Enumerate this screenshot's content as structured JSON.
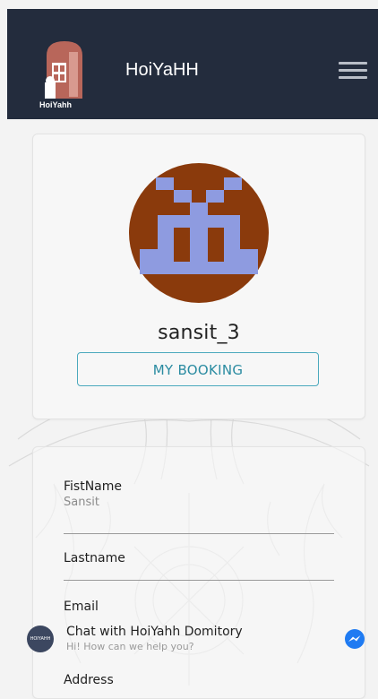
{
  "navbar": {
    "brand_logo_text": "HoiYahh",
    "brand_title": "HoiYaHH",
    "menu_icon": "hamburger-icon"
  },
  "profile": {
    "username": "sansit_3",
    "booking_button": "MY BOOKING",
    "avatar_colors": {
      "background": "#8a3a0c",
      "pattern": "#8e9be0"
    }
  },
  "form": {
    "fields": [
      {
        "label": "FistName",
        "value": "Sansit"
      },
      {
        "label": "Lastname",
        "value": ""
      },
      {
        "label": "Email",
        "value": ""
      },
      {
        "label": "Address",
        "value": ""
      }
    ]
  },
  "chat": {
    "title": "Chat with HoiYahh Domitory",
    "subtitle": "Hi! How can we help you?",
    "logo_text": "HOIYAHH",
    "icon": "messenger-icon"
  },
  "colors": {
    "navbar": "#232c3d",
    "accent": "#2a8ba1",
    "messenger": "#1f7bf2"
  }
}
